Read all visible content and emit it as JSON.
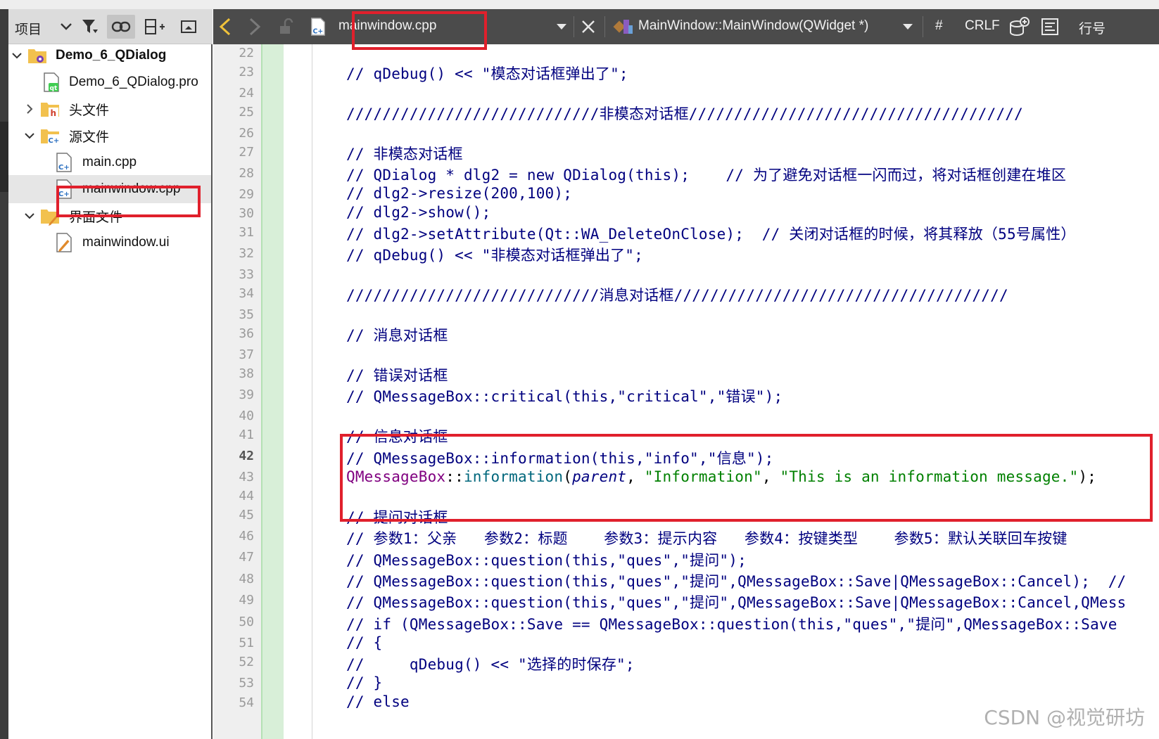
{
  "project_panel": {
    "title": "项目",
    "items": [
      {
        "label": "Demo_6_QDialog",
        "bold": true,
        "expanded": true
      },
      {
        "label": "Demo_6_QDialog.pro"
      },
      {
        "label": "头文件",
        "expanded": false
      },
      {
        "label": "源文件",
        "expanded": true
      },
      {
        "label": "main.cpp"
      },
      {
        "label": "mainwindow.cpp",
        "selected": true
      },
      {
        "label": "界面文件",
        "expanded": true
      },
      {
        "label": "mainwindow.ui"
      }
    ]
  },
  "editor_toolbar": {
    "file_name": "mainwindow.cpp",
    "symbol": "MainWindow::MainWindow(QWidget *)",
    "hash": "#",
    "line_ending": "CRLF",
    "line_label": "行号"
  },
  "editor": {
    "current_line": 42,
    "line_numbers": [
      22,
      23,
      24,
      25,
      26,
      27,
      28,
      29,
      30,
      31,
      32,
      33,
      34,
      35,
      36,
      37,
      38,
      39,
      40,
      41,
      42,
      43,
      44,
      45,
      46,
      47,
      48,
      49,
      50,
      51,
      52,
      53,
      54
    ],
    "lines": {
      "l23": "// qDebug() << \"模态对话框弹出了\";",
      "l25": "////////////////////////////非模态对话框/////////////////////////////////////",
      "l27": "// 非模态对话框",
      "l28": "// QDialog * dlg2 = new QDialog(this);    // 为了避免对话框一闪而过，将对话框创建在堆区",
      "l29": "// dlg2->resize(200,100);",
      "l30": "// dlg2->show();",
      "l31": "// dlg2->setAttribute(Qt::WA_DeleteOnClose);  // 关闭对话框的时候，将其释放（55号属性）",
      "l32": "// qDebug() << \"非模态对话框弹出了\";",
      "l34": "////////////////////////////消息对话框/////////////////////////////////////",
      "l36": "// 消息对话框",
      "l38": "// 错误对话框",
      "l39": "// QMessageBox::critical(this,\"critical\",\"错误\");",
      "l41": "// 信息对话框",
      "l42": "// QMessageBox::information(this,\"info\",\"信息\");",
      "l43_class": "QMessageBox",
      "l43_sep": "::",
      "l43_fn": "information",
      "l43_open": "(",
      "l43_param": "parent",
      "l43_comma1": ", ",
      "l43_str1": "\"Information\"",
      "l43_comma2": ", ",
      "l43_str2": "\"This is an information message.\"",
      "l43_close": ");",
      "l45": "// 提问对话框",
      "l46": "// 参数1：父亲   参数2：标题    参数3：提示内容   参数4：按键类型    参数5：默认关联回车按键",
      "l47": "// QMessageBox::question(this,\"ques\",\"提问\");",
      "l48": "// QMessageBox::question(this,\"ques\",\"提问\",QMessageBox::Save|QMessageBox::Cancel);  //",
      "l49": "// QMessageBox::question(this,\"ques\",\"提问\",QMessageBox::Save|QMessageBox::Cancel,QMess",
      "l50": "// if (QMessageBox::Save == QMessageBox::question(this,\"ques\",\"提问\",QMessageBox::Save",
      "l51": "// {",
      "l52": "//     qDebug() << \"选择的时保存\";",
      "l53": "// }",
      "l54": "// else"
    }
  },
  "watermark": "CSDN @视觉研坊",
  "colors": {
    "annotation_red": "#e0202c",
    "comment": "#00007f",
    "string": "#008000",
    "class": "#800080",
    "toolbar_dark": "#4b4b4b"
  }
}
